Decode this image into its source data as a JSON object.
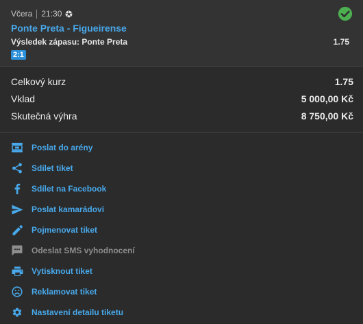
{
  "bet": {
    "day": "Včera",
    "time": "21:30",
    "sport_icon": "soccer-ball-icon",
    "status_icon": "check-circle-icon",
    "event": "Ponte Preta - Figueirense",
    "market": "Výsledek zápasu: Ponte Preta",
    "odd": "1.75",
    "score": "2:1"
  },
  "summary": {
    "total_odds_label": "Celkový kurz",
    "total_odds": "1.75",
    "stake_label": "Vklad",
    "stake": "5 000,00 Kč",
    "win_label": "Skutečná výhra",
    "win": "8 750,00 Kč"
  },
  "actions": [
    {
      "label": "Poslat do arény",
      "icon": "arena-icon",
      "enabled": true
    },
    {
      "label": "Sdílet tiket",
      "icon": "share-icon",
      "enabled": true
    },
    {
      "label": "Sdílet na Facebook",
      "icon": "facebook-icon",
      "enabled": true
    },
    {
      "label": "Poslat kamarádovi",
      "icon": "send-icon",
      "enabled": true
    },
    {
      "label": "Pojmenovat tiket",
      "icon": "pencil-icon",
      "enabled": true
    },
    {
      "label": "Odeslat SMS vyhodnocení",
      "icon": "sms-icon",
      "enabled": false
    },
    {
      "label": "Vytisknout tiket",
      "icon": "print-icon",
      "enabled": true
    },
    {
      "label": "Reklamovat tiket",
      "icon": "sad-face-icon",
      "enabled": true
    },
    {
      "label": "Nastavení detailu tiketu",
      "icon": "gear-icon",
      "enabled": true
    }
  ],
  "colors": {
    "accent": "#48a8ea",
    "success": "#4caf50",
    "disabled": "#8d8d8d",
    "background": "#2b2b2b",
    "panel": "#333333"
  }
}
